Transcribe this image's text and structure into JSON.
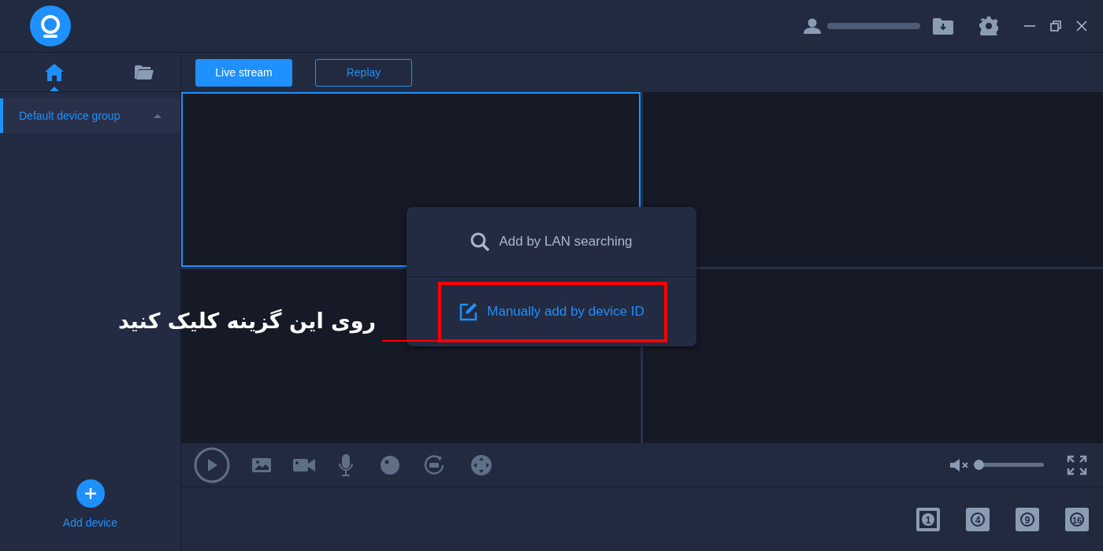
{
  "sidebar": {
    "tabs": [
      {
        "kind": "home",
        "selected": true
      },
      {
        "kind": "folder",
        "selected": false
      }
    ],
    "groups": [
      {
        "label": "Default device group",
        "selected": true,
        "expanded": true
      }
    ],
    "add_device": "Add device"
  },
  "view_tabs": [
    {
      "label": "Live stream",
      "selected": true
    },
    {
      "label": "Replay",
      "selected": false
    }
  ],
  "video_tiles": [
    {
      "selected": true
    },
    {
      "selected": false
    },
    {
      "selected": false
    },
    {
      "selected": false
    }
  ],
  "volume": {
    "muted": true,
    "level": 0
  },
  "layouts": [
    {
      "label": "1"
    },
    {
      "label": "4"
    },
    {
      "label": "9"
    },
    {
      "label": "16"
    }
  ],
  "popup_menu": [
    {
      "kind": "search",
      "label": "Add by LAN searching",
      "selected": false
    },
    {
      "kind": "edit",
      "label": "Manually add by device ID",
      "selected": true
    }
  ],
  "annotation": {
    "text": "روی این گزینه کلیک کنید"
  }
}
